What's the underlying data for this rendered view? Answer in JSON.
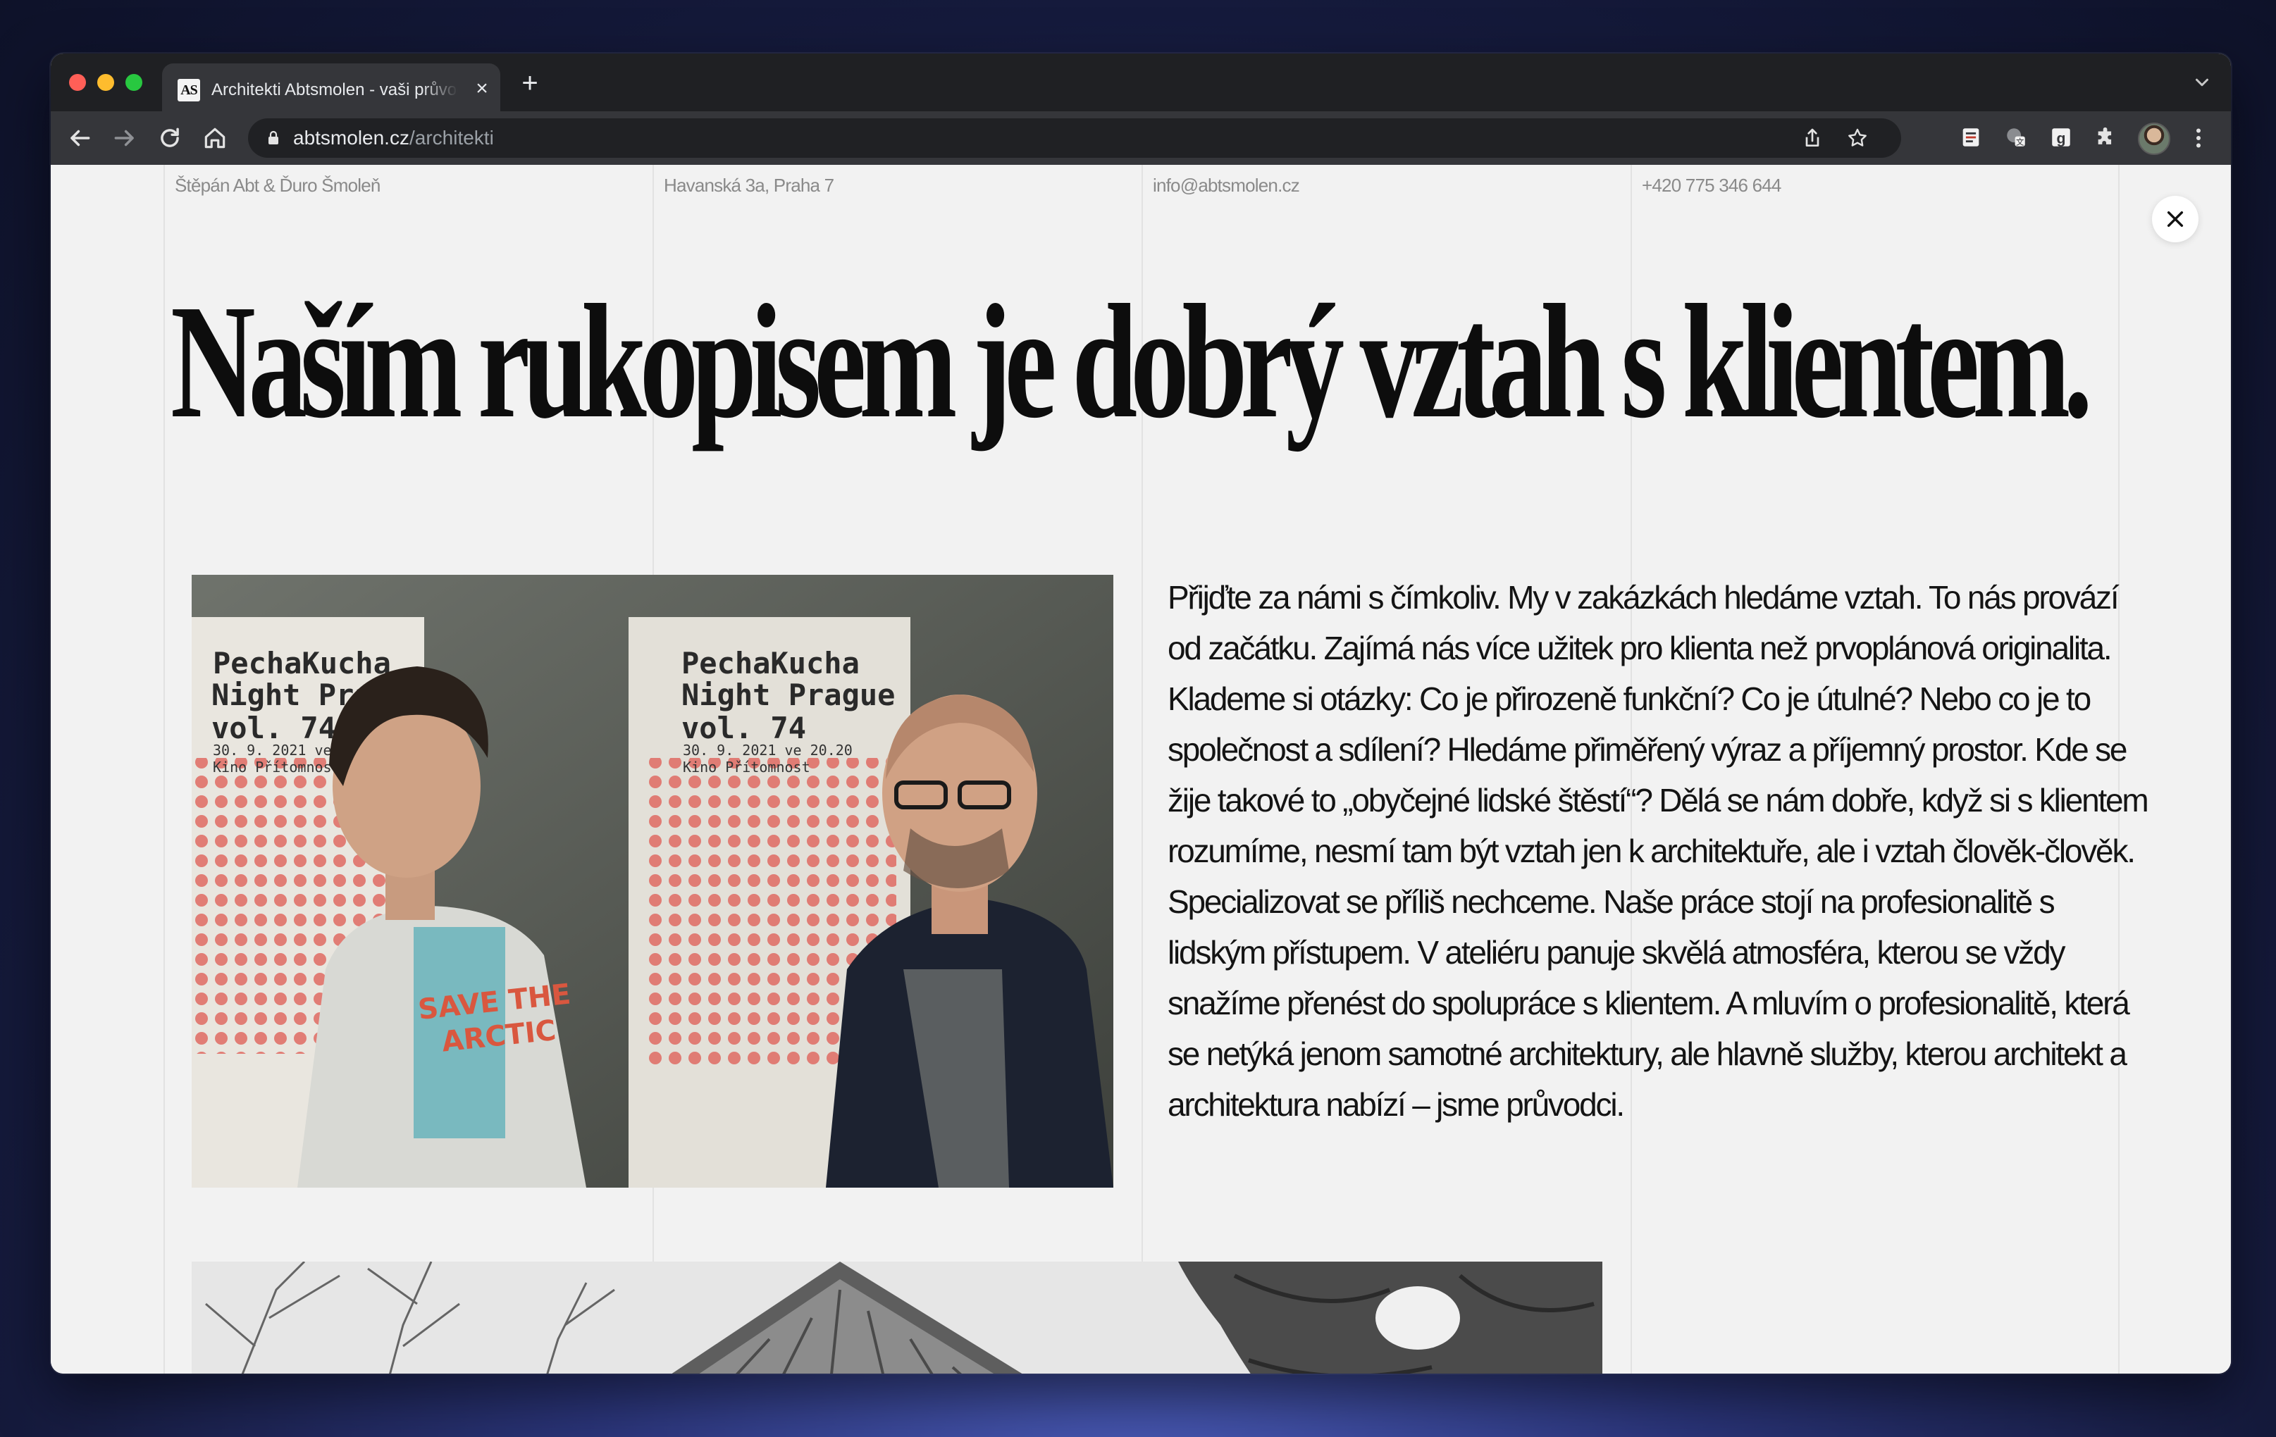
{
  "browser": {
    "tab": {
      "favicon_text": "AS",
      "title": "Architekti Abtsmolen - vaši průvodci",
      "close_symbol": "×"
    },
    "new_tab_symbol": "+",
    "url_host": "abtsmolen.cz",
    "url_path": "/architekti",
    "icons": [
      "back-icon",
      "forward-icon",
      "reload-icon",
      "home-icon",
      "lock-icon",
      "share-icon",
      "bookmark-star-icon",
      "extension-reader-icon",
      "extension-translate-icon",
      "extension-grammar-icon",
      "extensions-puzzle-icon",
      "profile-avatar",
      "menu-dots-icon",
      "tab-list-chevron-icon"
    ]
  },
  "page": {
    "meta": {
      "names": "Štěpán Abt & Ďuro Šmoleň",
      "address": "Havanská 3a, Praha 7",
      "email": "info@abtsmolen.cz",
      "phone": "+420 775 346 644"
    },
    "headline": "Naším rukopisem je dobrý vztah s klientem.",
    "body": "Přijďte za námi s čímkoliv. My v zakázkách hledáme vztah. To nás provází od začátku. Zajímá nás více užitek pro klienta než prvoplánová originalita. Klademe si otázky: Co je přirozeně funkční? Co je útulné? Nebo co je to společnost a sdílení? Hledáme přiměřený výraz a příjemný prostor. Kde se žije takové to „obyčejné lidské štěstí“? Dělá se nám dobře, když si s klientem rozumíme, nesmí tam být vztah jen k architektuře, ale i vztah člověk-člověk. Specializovat se příliš nechceme. Naše práce stojí na profesionalitě s lidským přístupem. V ateliéru panuje skvělá atmosféra, kterou se vždy snažíme přenést do spolupráce s klientem. A mluvím o profesionalitě, která se netýká jenom samotné architektury, ale hlavně služby, kterou architekt a architektura nabízí – jsme průvodci.",
    "photo1": {
      "poster_title_1": "PechaKucha",
      "poster_title_2": "Night Prague",
      "poster_title_3": "vol. 74",
      "poster_date": "30. 9. 2021 ve 20.20",
      "poster_venue": "Kino Přítomnost",
      "shirt_text_1": "SAVE THE",
      "shirt_text_2": "ARCTIC"
    },
    "close_symbol": "×"
  },
  "colors": {
    "page_bg": "#f2f2f2",
    "text": "#0d0d0d",
    "meta_text": "#8a8a8a",
    "chrome_dark": "#1f2023",
    "chrome_toolbar": "#35363a"
  }
}
